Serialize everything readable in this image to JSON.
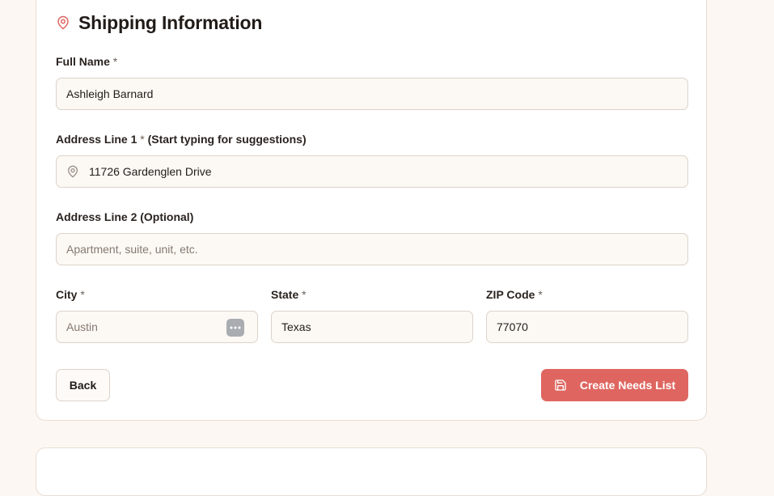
{
  "section": {
    "title": "Shipping Information",
    "icon": "map-pin-icon",
    "accent_color": "#df6660"
  },
  "form": {
    "full_name": {
      "label": "Full Name",
      "required_mark": "*",
      "value": "Ashleigh Barnard"
    },
    "address_line_1": {
      "label": "Address Line 1",
      "required_mark": "*",
      "hint": "(Start typing for suggestions)",
      "value": "11726 Gardenglen Drive",
      "icon": "map-pin-icon"
    },
    "address_line_2": {
      "label": "Address Line 2 (Optional)",
      "placeholder": "Apartment, suite, unit, etc.",
      "value": ""
    },
    "city": {
      "label": "City",
      "required_mark": "*",
      "value": "Austin",
      "icon": "more-dots-icon"
    },
    "state": {
      "label": "State",
      "required_mark": "*",
      "value": "Texas"
    },
    "zip": {
      "label": "ZIP Code",
      "required_mark": "*",
      "value": "77070"
    }
  },
  "actions": {
    "back_label": "Back",
    "create_label": "Create Needs List",
    "create_icon": "save-icon"
  }
}
